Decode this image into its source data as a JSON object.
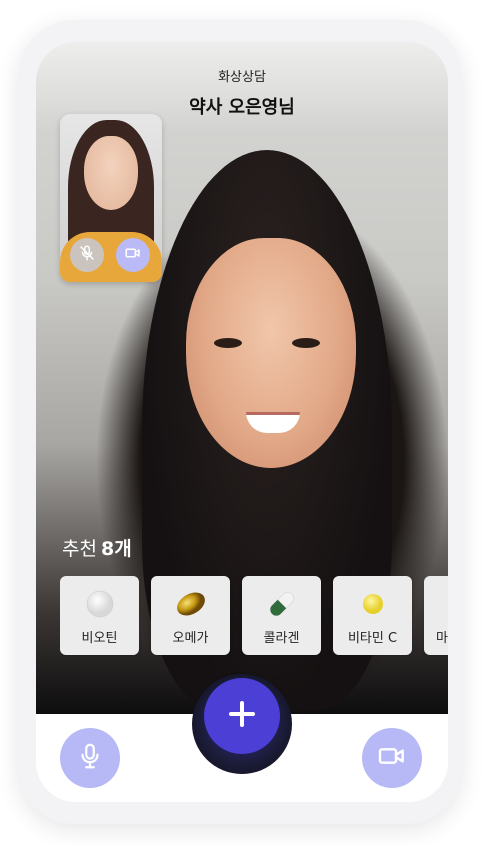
{
  "header": {
    "subtitle": "화상상담",
    "title": "약사 오은영님"
  },
  "self_view": {
    "mic_icon": "mic-off-icon",
    "camera_icon": "video-camera-icon"
  },
  "recommendations": {
    "label": "추천",
    "count": "8개",
    "items": [
      {
        "label": "비오틴",
        "pill": "white-round-tablet"
      },
      {
        "label": "오메가",
        "pill": "gold-softgel"
      },
      {
        "label": "콜라겐",
        "pill": "green-white-capsule"
      },
      {
        "label": "비타민 C",
        "pill": "yellow-round-tablet"
      },
      {
        "label": "마",
        "pill": "partial-card"
      }
    ]
  },
  "controls": {
    "add_icon": "plus-icon",
    "mic_icon": "microphone-icon",
    "camera_icon": "video-camera-icon"
  },
  "colors": {
    "accent": "#4b3fd6",
    "control_light": "#b6b9f5"
  }
}
